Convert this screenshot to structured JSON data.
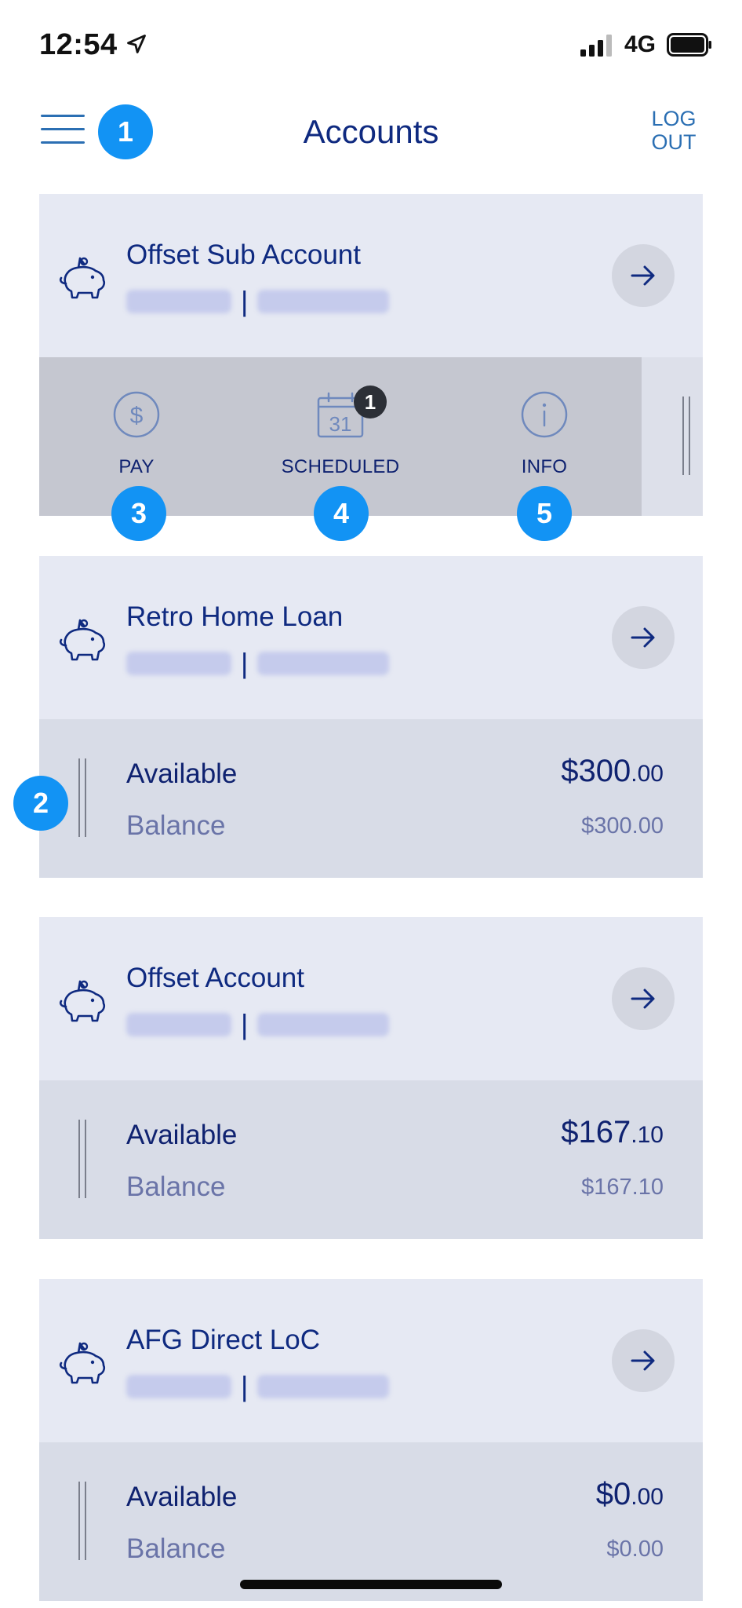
{
  "status_bar": {
    "time": "12:54",
    "network": "4G",
    "location_icon": "location-arrow-icon",
    "signal_icon": "cellular-signal-icon",
    "battery_icon": "battery-icon"
  },
  "header": {
    "title": "Accounts",
    "logout_line1": "LOG",
    "logout_line2": "OUT",
    "menu_icon": "hamburger-menu-icon"
  },
  "callouts": [
    "1",
    "2",
    "3",
    "4",
    "5"
  ],
  "actions": {
    "pay_label": "PAY",
    "scheduled_label": "SCHEDULED",
    "scheduled_count": "1",
    "info_label": "INFO"
  },
  "accounts": [
    {
      "name": "Offset Sub Account"
    },
    {
      "name": "Retro Home Loan",
      "available_label": "Available",
      "balance_label": "Balance",
      "available_dollars": "$300",
      "available_cents": ".00",
      "balance": "$300.00"
    },
    {
      "name": "Offset Account",
      "available_label": "Available",
      "balance_label": "Balance",
      "available_dollars": "$167",
      "available_cents": ".10",
      "balance": "$167.10"
    },
    {
      "name": "AFG Direct LoC",
      "available_label": "Available",
      "balance_label": "Balance",
      "available_dollars": "$0",
      "available_cents": ".00",
      "balance": "$0.00"
    }
  ],
  "colors": {
    "accent": "#1293f4",
    "navy": "#0f2a80",
    "card": "#e6e9f3",
    "card_detail": "#d8dce7"
  }
}
